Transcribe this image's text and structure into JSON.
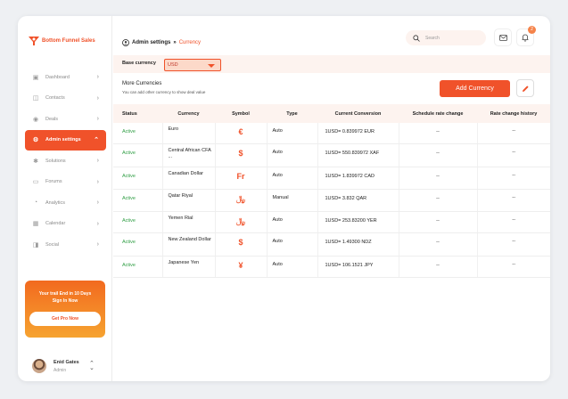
{
  "brand": {
    "name": "Bottom Funnel Sales",
    "color": "#f0522a"
  },
  "sidebar": {
    "items": [
      {
        "label": "Dashboard",
        "icon": "dashboard-icon",
        "glyph": "▣"
      },
      {
        "label": "Contacts",
        "icon": "contacts-icon",
        "glyph": "◫"
      },
      {
        "label": "Deals",
        "icon": "deals-icon",
        "glyph": "◉"
      },
      {
        "label": "Admin settings",
        "icon": "admin-icon",
        "glyph": "⚙"
      },
      {
        "label": "Solutions",
        "icon": "solutions-icon",
        "glyph": "✱"
      },
      {
        "label": "Forums",
        "icon": "forums-icon",
        "glyph": "▭"
      },
      {
        "label": "Analytics",
        "icon": "analytics-icon",
        "glyph": "◔"
      },
      {
        "label": "Calendar",
        "icon": "calendar-icon",
        "glyph": "▦"
      },
      {
        "label": "Social",
        "icon": "social-icon",
        "glyph": "◨"
      }
    ],
    "promo": {
      "line1": "Your trail End in 10 Days",
      "line2": "Sign In Now",
      "button": "Get Pro Now"
    },
    "user": {
      "name": "Enid Gates",
      "role": "Admin"
    }
  },
  "header": {
    "breadcrumb": {
      "root": "Admin settings",
      "separator": "»",
      "current": "Currency"
    },
    "search": {
      "placeholder": "Search"
    },
    "notifications_count": "2"
  },
  "base_currency": {
    "label": "Base currency",
    "value": "USD"
  },
  "more": {
    "title": "More Currencies",
    "subtitle": "You can add other currency to show deal value",
    "add_button": "Add Currency"
  },
  "table": {
    "headers": [
      "Status",
      "Currency",
      "Symbol",
      "Type",
      "Current Conversion",
      "Schedule rate change",
      "Rate change history"
    ],
    "rows": [
      {
        "status": "Active",
        "currency": "Euro",
        "symbol": "€",
        "type": "Auto",
        "conversion": "1USD= 0.839972 EUR",
        "schedule": "--",
        "history": "--"
      },
      {
        "status": "Active",
        "currency": "Central African CFA ...",
        "symbol": "$",
        "type": "Auto",
        "conversion": "1USD= 550.839972 XAF",
        "schedule": "--",
        "history": "--"
      },
      {
        "status": "Active",
        "currency": "Canadian Dollar",
        "symbol": "Fr",
        "type": "Auto",
        "conversion": "1USD= 1.839972 CAD",
        "schedule": "--",
        "history": "--"
      },
      {
        "status": "Active",
        "currency": "Qatar Riyal",
        "symbol": "﷼",
        "type": "Manual",
        "conversion": "1USD= 3.832 QAR",
        "schedule": "--",
        "history": "--"
      },
      {
        "status": "Active",
        "currency": "Yemen Rial",
        "symbol": "﷼",
        "type": "Auto",
        "conversion": "1USD= 253.83200 YER",
        "schedule": "--",
        "history": "--"
      },
      {
        "status": "Active",
        "currency": "New Zealand Dollar",
        "symbol": "$",
        "type": "Auto",
        "conversion": "1USD= 1.49300 NDZ",
        "schedule": "--",
        "history": "--"
      },
      {
        "status": "Active",
        "currency": "Japanese Yen",
        "symbol": "¥",
        "type": "Auto",
        "conversion": "1USD= 106.1521 JPY",
        "schedule": "--",
        "history": "--"
      }
    ]
  }
}
